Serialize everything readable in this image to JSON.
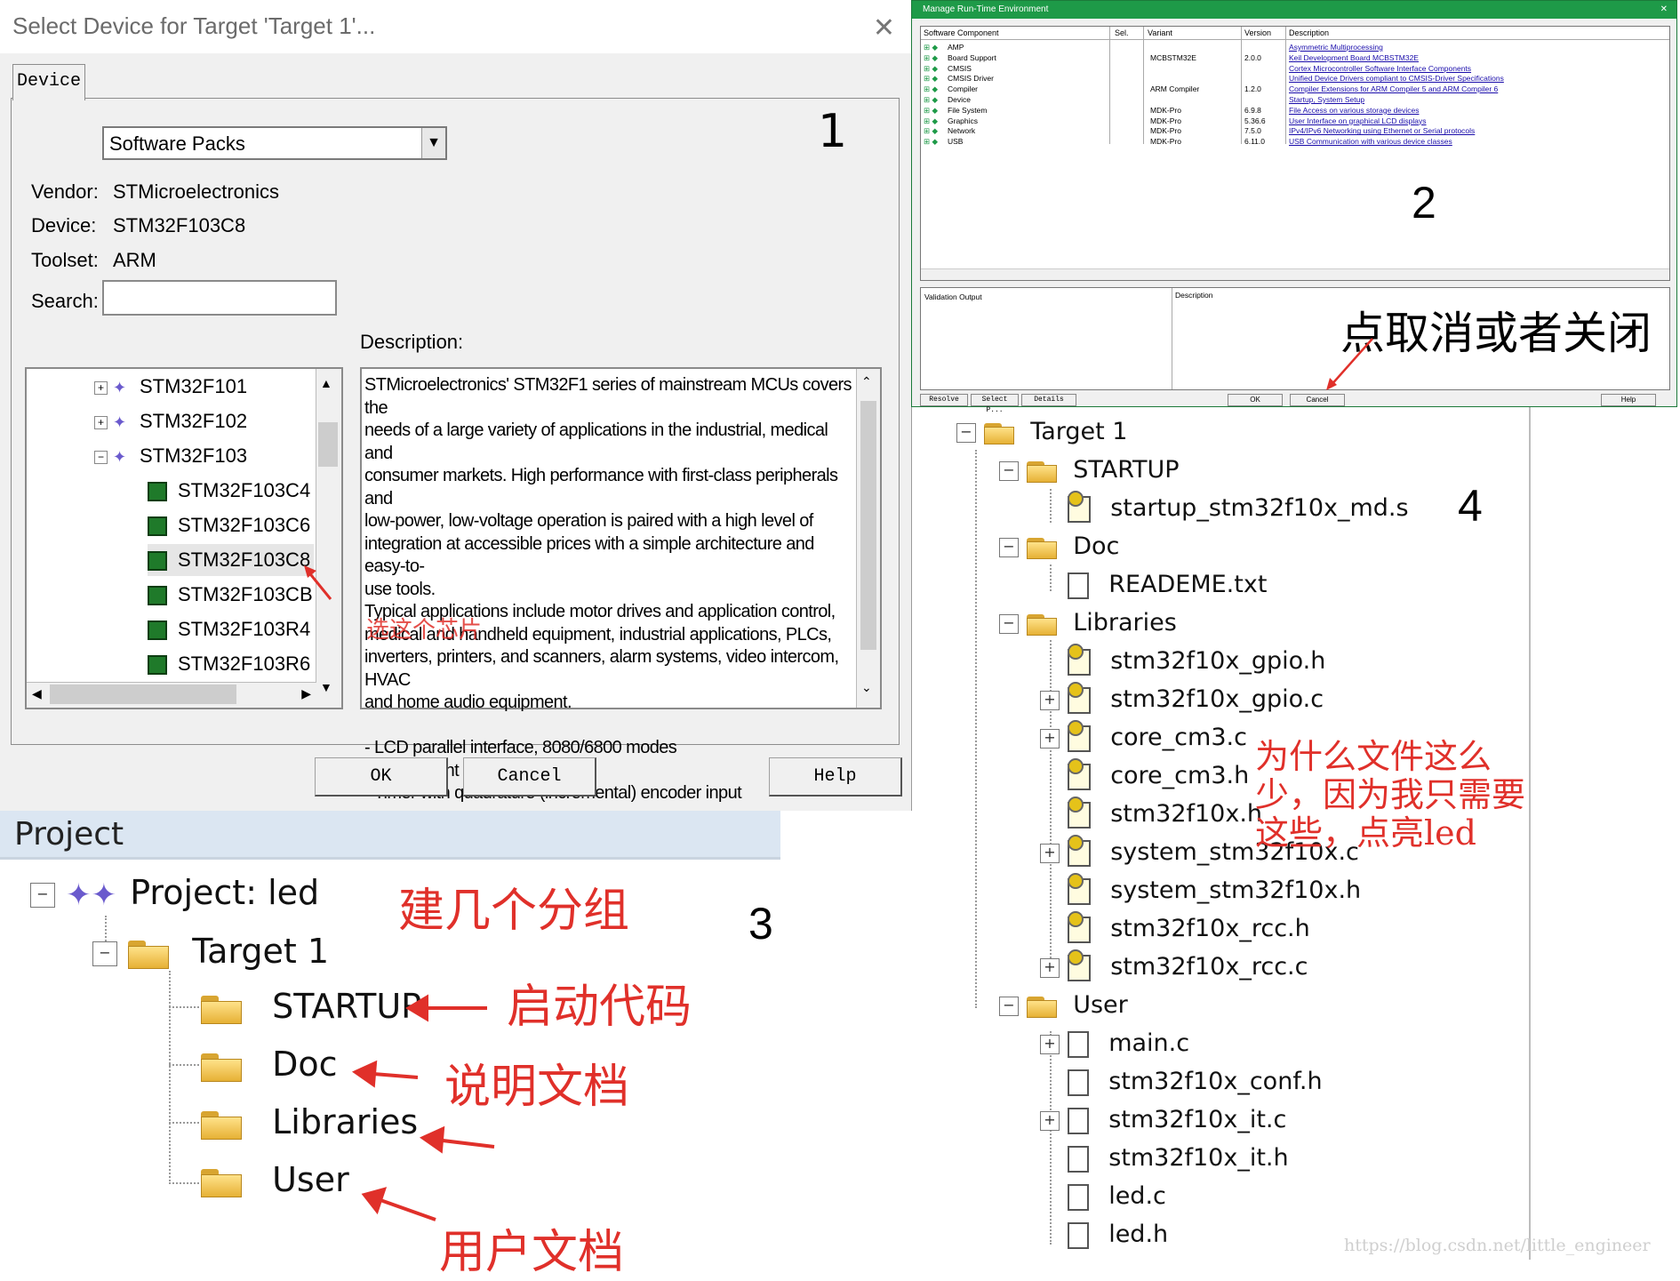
{
  "panel1": {
    "title": "Select Device for Target 'Target 1'...",
    "close": "✕",
    "tab": "Device",
    "database": "Software Packs",
    "vendor_label": "Vendor:",
    "vendor": "STMicroelectronics",
    "device_label": "Device:",
    "device": "STM32F103C8",
    "toolset_label": "Toolset:",
    "toolset": "ARM",
    "search_label": "Search:",
    "search_value": "",
    "description_label": "Description:",
    "tree_groups": [
      "STM32F101",
      "STM32F102",
      "STM32F103"
    ],
    "tree_devices": [
      "STM32F103C4",
      "STM32F103C6",
      "STM32F103C8",
      "STM32F103CB",
      "STM32F103R4",
      "STM32F103R6"
    ],
    "description_lines": [
      "STMicroelectronics' STM32F1 series of mainstream MCUs covers the",
      "needs of a large variety of applications in the industrial, medical and",
      "consumer markets. High performance with first-class peripherals and",
      "low-power, low-voltage operation is paired with a high level of",
      "integration at accessible prices with a simple architecture and easy-to-",
      "use tools.",
      "Typical applications include motor drives and application control,",
      "medical and handheld equipment, industrial applications, PLCs,",
      "inverters, printers, and scanners, alarm systems, video intercom, HVAC",
      "and home audio equipment.",
      "",
      "- LCD parallel interface, 8080/6800 modes",
      "- 5 V-tolerant I/Os",
      "- Timer with quadrature (incremental) encoder input"
    ],
    "annotation_select_chip": "选这个芯片",
    "ok": "OK",
    "cancel": "Cancel",
    "help": "Help",
    "step_number": "1"
  },
  "panel2": {
    "title": "Manage Run-Time Environment",
    "close": "✕",
    "columns": [
      "Software Component",
      "Sel.",
      "Variant",
      "Version",
      "Description"
    ],
    "rows": [
      {
        "component": "AMP",
        "variant": "",
        "version": "",
        "description": "Asymmetric Multiprocessing"
      },
      {
        "component": "Board Support",
        "variant": "MCBSTM32E",
        "version": "2.0.0",
        "description": "Keil Development Board MCBSTM32E"
      },
      {
        "component": "CMSIS",
        "variant": "",
        "version": "",
        "description": "Cortex Microcontroller Software Interface Components"
      },
      {
        "component": "CMSIS Driver",
        "variant": "",
        "version": "",
        "description": "Unified Device Drivers compliant to CMSIS-Driver Specifications"
      },
      {
        "component": "Compiler",
        "variant": "ARM Compiler",
        "version": "1.2.0",
        "description": "Compiler Extensions for ARM Compiler 5 and ARM Compiler 6"
      },
      {
        "component": "Device",
        "variant": "",
        "version": "",
        "description": "Startup, System Setup"
      },
      {
        "component": "File System",
        "variant": "MDK-Pro",
        "version": "6.9.8",
        "description": "File Access on various storage devices"
      },
      {
        "component": "Graphics",
        "variant": "MDK-Pro",
        "version": "5.36.6",
        "description": "User Interface on graphical LCD displays"
      },
      {
        "component": "Network",
        "variant": "MDK-Pro",
        "version": "7.5.0",
        "description": "IPv4/IPv6 Networking using Ethernet or Serial protocols"
      },
      {
        "component": "USB",
        "variant": "MDK-Pro",
        "version": "6.11.0",
        "description": "USB Communication with various device classes"
      }
    ],
    "validation_output": "Validation Output",
    "validation_description": "Description",
    "buttons": {
      "resolve": "Resolve",
      "select_packs": "Select P...",
      "details": "Details",
      "ok": "OK",
      "cancel": "Cancel",
      "help": "Help"
    },
    "annotation_cancel": "点取消或者关闭",
    "step_number": "2"
  },
  "panel3": {
    "header": "Project",
    "project": "Project: led",
    "target": "Target 1",
    "groups": [
      "STARTUP",
      "Doc",
      "Libraries",
      "User"
    ],
    "annotation_groups": "建几个分组",
    "annotation_startup": "启动代码",
    "annotation_doc": "说明文档",
    "annotation_user": "用户文档",
    "step_number": "3"
  },
  "panel4": {
    "target": "Target 1",
    "startup_group": "STARTUP",
    "startup_files": [
      "startup_stm32f10x_md.s"
    ],
    "doc_group": "Doc",
    "doc_files": [
      "READEME.txt"
    ],
    "libraries_group": "Libraries",
    "library_files": [
      "stm32f10x_gpio.h",
      "stm32f10x_gpio.c",
      "core_cm3.c",
      "core_cm3.h",
      "stm32f10x.h",
      "system_stm32f10x.c",
      "system_stm32f10x.h",
      "stm32f10x_rcc.h",
      "stm32f10x_rcc.c"
    ],
    "user_group": "User",
    "user_files": [
      "main.c",
      "stm32f10x_conf.h",
      "stm32f10x_it.c",
      "stm32f10x_it.h",
      "led.c",
      "led.h"
    ],
    "annotation_lines": [
      "为什么文件这么",
      "少，因为我只需要",
      "这些，点亮led"
    ],
    "step_number": "4"
  },
  "watermark": "https://blog.csdn.net/little_engineer",
  "colors": {
    "annotation_red": "#e0302a",
    "rte_title_green": "#1e9a48",
    "link_blue": "#1a0dab"
  }
}
